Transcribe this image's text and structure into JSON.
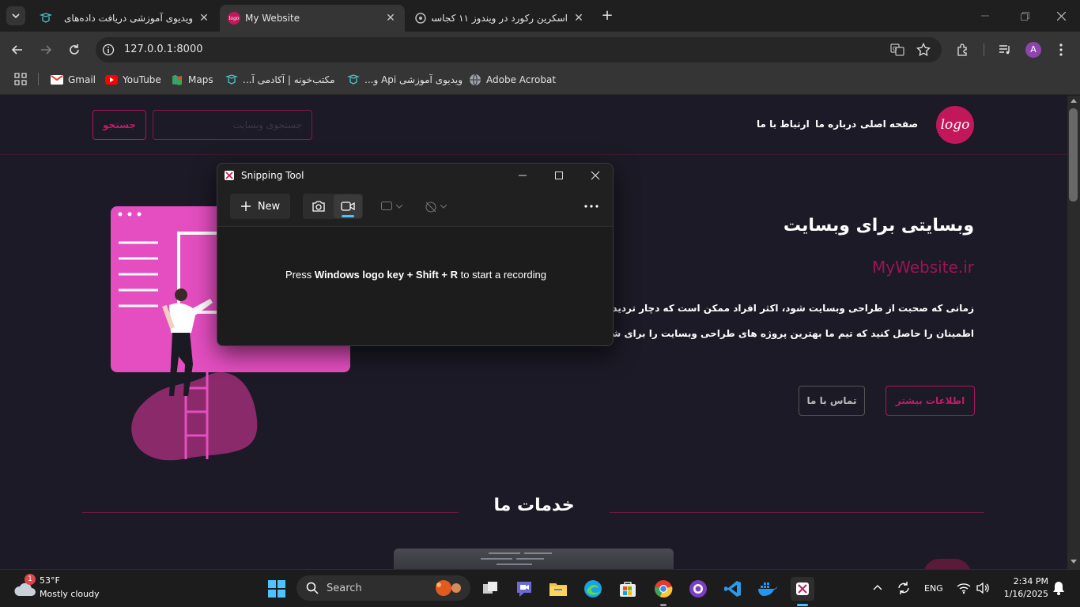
{
  "browser": {
    "tabs": [
      {
        "title": "ویدیوی آموزشی دریافت داده‌های",
        "icon": "academy-icon",
        "active": false
      },
      {
        "title": "My Website",
        "icon": "logo-icon",
        "active": true
      },
      {
        "title": "اسکرین رکورد در ویندوز ۱۱ کجاست",
        "icon": "edge-page-icon",
        "active": false
      }
    ],
    "url": "127.0.0.1:8000",
    "bookmarks": [
      {
        "label": "Gmail",
        "icon": "gmail-icon"
      },
      {
        "label": "YouTube",
        "icon": "youtube-icon"
      },
      {
        "label": "Maps",
        "icon": "maps-icon"
      },
      {
        "label": "مکتب‌خونه | آکادمی آ...",
        "icon": "academy-icon"
      },
      {
        "label": "ویدیوی آموزشی Api و...",
        "icon": "academy-icon"
      },
      {
        "label": "Adobe Acrobat",
        "icon": "globe-icon"
      }
    ],
    "profile_initial": "A"
  },
  "site": {
    "logo_text": "logo",
    "nav": [
      "صفحه اصلی",
      "درباره ما",
      "ارتباط با ما"
    ],
    "search_placeholder": "جستجوی وبسایت",
    "search_button": "جستجو",
    "hero_title": "وبسایتی برای وبسایت",
    "hero_subtitle": "MyWebsite.ir",
    "hero_line1": "زمانی که صحبت از طراحی وبسایت شود، اکثر افراد ممکن است که دچار تردید و یا س",
    "hero_line2": "اطمینان را حاصل کنید که تیم ما بهترین پروژه های طراحی وبسایت را برای شما ارائ",
    "btn_more": "اطلاعات بیشتر",
    "btn_contact": "تماس با ما",
    "services_title": "خدمات ما"
  },
  "snipping": {
    "title": "Snipping Tool",
    "new_label": "New",
    "msg_pre": "Press ",
    "msg_bold": "Windows logo key + Shift + R",
    "msg_post": " to start a recording"
  },
  "taskbar": {
    "weather_temp": "53°F",
    "weather_desc": "Mostly cloudy",
    "weather_badge": "1",
    "search_label": "Search",
    "language": "ENG",
    "time": "2:34 PM",
    "date": "1/16/2025"
  },
  "colors": {
    "accent": "#c2185b",
    "page_bg": "#1b1a26",
    "illustration": "#e040b5"
  }
}
